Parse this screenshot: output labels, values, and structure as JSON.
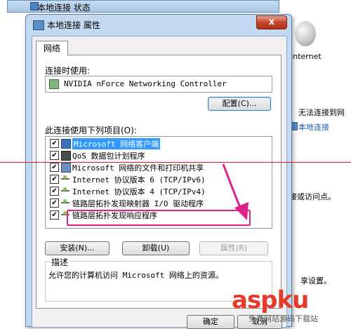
{
  "background": {
    "internet_label": "Internet",
    "no_connection": "无法连接到网",
    "local_connection": "本地连接",
    "access_point": "接或访问点。",
    "settings": "享设置。"
  },
  "back_window": {
    "title": "本地连接 状态"
  },
  "dialog": {
    "title": "本地连接 属性",
    "close_glyph": "x",
    "tab_label": "网络",
    "connect_using_label": "连接时使用:",
    "adapter_name": "NVIDIA nForce Networking Controller",
    "configure_button": "配置(C)...",
    "items_label": "此连接使用下列项目(O):",
    "items": [
      {
        "label": "Microsoft 网络客户端",
        "checked": true,
        "icon": "network-client-icon"
      },
      {
        "label": "QoS 数据包计划程序",
        "checked": true,
        "icon": "qos-icon"
      },
      {
        "label": "Microsoft 网络的文件和打印机共享",
        "checked": true,
        "icon": "share-icon"
      },
      {
        "label": "Internet 协议版本 6 (TCP/IPv6)",
        "checked": true,
        "icon": "protocol-icon"
      },
      {
        "label": "Internet 协议版本 4 (TCP/IPv4)",
        "checked": true,
        "icon": "protocol-icon"
      },
      {
        "label": "链路层拓扑发现映射器 I/O 驱动程序",
        "checked": true,
        "icon": "protocol-icon"
      },
      {
        "label": "链路层拓扑发现响应程序",
        "checked": true,
        "icon": "protocol-icon"
      }
    ],
    "check_glyph": "✔",
    "install_button": "安装(N)...",
    "uninstall_button": "卸载(U)",
    "properties_button": "属性(R)",
    "description_title": "描述",
    "description_text": "允许您的计算机访问 Microsoft 网络上的资源。",
    "ok_button": "确定",
    "cancel_button": "取消"
  },
  "watermark": {
    "main": "aspku",
    "sub": "免费网站源码下载站",
    "color": "#e83a2b"
  },
  "colors": {
    "highlight": "#3399ff",
    "annotation": "#e0218a",
    "red_line": "#e02020"
  }
}
